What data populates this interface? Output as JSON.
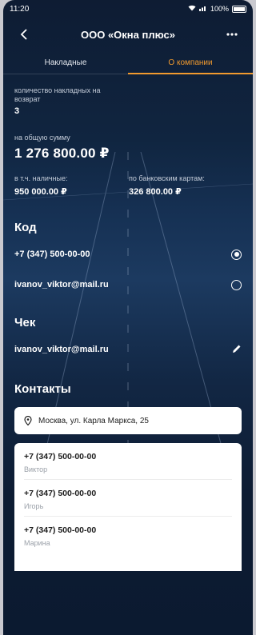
{
  "status_bar": {
    "time": "11:20",
    "battery": "100%"
  },
  "header": {
    "title": "ООО «Окна плюс»"
  },
  "tabs": [
    {
      "label": "Накладные",
      "active": false
    },
    {
      "label": "О компании",
      "active": true
    }
  ],
  "stats": {
    "returns_label": "количество накладных на возврат",
    "returns_count": "3",
    "total_label": "на общую сумму",
    "total_value": "1 276 800.00 ₽",
    "cash_label": "в т.ч. наличные:",
    "cash_value": "950 000.00 ₽",
    "card_label": "по банковским картам:",
    "card_value": "326 800.00 ₽"
  },
  "code_section": {
    "heading": "Код",
    "options": [
      {
        "value": "+7 (347) 500-00-00",
        "selected": true
      },
      {
        "value": "ivanov_viktor@mail.ru",
        "selected": false
      }
    ]
  },
  "receipt_section": {
    "heading": "Чек",
    "email": "ivanov_viktor@mail.ru"
  },
  "contacts_section": {
    "heading": "Контакты",
    "address": "Москва, ул. Карла Маркса, 25",
    "phones": [
      {
        "number": "+7 (347) 500-00-00",
        "name": "Виктор"
      },
      {
        "number": "+7 (347) 500-00-00",
        "name": "Игорь"
      },
      {
        "number": "+7 (347) 500-00-00",
        "name": "Марина"
      }
    ]
  },
  "colors": {
    "accent": "#f29a2e",
    "background": "#102540",
    "card": "#ffffff"
  }
}
